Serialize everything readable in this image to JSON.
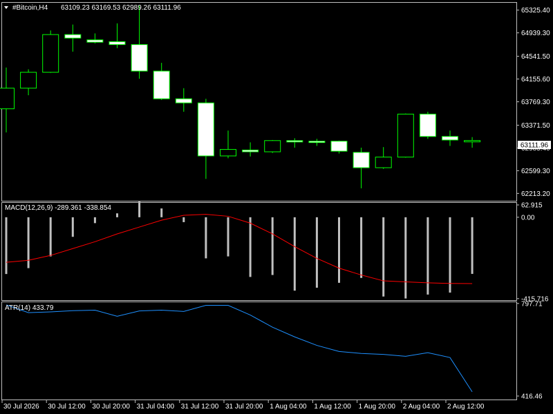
{
  "header": {
    "symbol_label": "#Bitcoin,H4",
    "ohlc_text": "63109.23 63169.53 62989.26 63111.96"
  },
  "price_axis": {
    "ticks": [
      "65325.40",
      "64939.30",
      "64541.50",
      "64155.60",
      "63769.30",
      "63371.50",
      "62985.40",
      "62599.30",
      "62213.20"
    ],
    "current_price": "63111.96"
  },
  "macd": {
    "label": "MACD(12,26,9) -289.361 -338.854",
    "axis_ticks": [
      "62.915",
      "0.00",
      "-415.716"
    ]
  },
  "atr": {
    "label": "ATR(14) 433.79",
    "axis_ticks": [
      "797.71",
      "416.46"
    ]
  },
  "time_axis": {
    "labels": [
      "30 Jul 2026",
      "30 Jul 12:00",
      "30 Jul 20:00",
      "31 Jul 04:00",
      "31 Jul 12:00",
      "31 Jul 20:00",
      "1 Aug 04:00",
      "1 Aug 12:00",
      "1 Aug 20:00",
      "2 Aug 04:00",
      "2 Aug 12:00"
    ]
  },
  "colors": {
    "background": "#000000",
    "frame": "#c0c0c0",
    "bull_candle_body": "#000000",
    "bear_candle_body": "#ffffff",
    "candle_wick": "#00ff00",
    "macd_histogram": "#c0c0c0",
    "macd_signal": "#ff0000",
    "atr_line": "#1e90ff",
    "text": "#ffffff"
  },
  "chart_data": [
    {
      "type": "candlestick",
      "title": "#Bitcoin,H4",
      "ylim": [
        62100,
        65450
      ],
      "y_ticks": [
        65325.4,
        64939.3,
        64541.5,
        64155.6,
        63769.3,
        63371.5,
        62985.4,
        62599.3,
        62213.2
      ],
      "candles": [
        {
          "o": 63650,
          "h": 64350,
          "l": 63250,
          "c": 64000
        },
        {
          "o": 64000,
          "h": 64320,
          "l": 63880,
          "c": 64270
        },
        {
          "o": 64270,
          "h": 64980,
          "l": 64260,
          "c": 64910
        },
        {
          "o": 64910,
          "h": 65080,
          "l": 64620,
          "c": 64850
        },
        {
          "o": 64820,
          "h": 64930,
          "l": 64760,
          "c": 64780
        },
        {
          "o": 64790,
          "h": 65100,
          "l": 64680,
          "c": 64740
        },
        {
          "o": 64740,
          "h": 65400,
          "l": 64160,
          "c": 64290
        },
        {
          "o": 64290,
          "h": 64430,
          "l": 63800,
          "c": 63820
        },
        {
          "o": 63820,
          "h": 64000,
          "l": 63600,
          "c": 63750
        },
        {
          "o": 63750,
          "h": 63820,
          "l": 62460,
          "c": 62850
        },
        {
          "o": 62850,
          "h": 63280,
          "l": 62810,
          "c": 62960
        },
        {
          "o": 62950,
          "h": 63080,
          "l": 62840,
          "c": 62920
        },
        {
          "o": 62920,
          "h": 63120,
          "l": 62900,
          "c": 63110
        },
        {
          "o": 63110,
          "h": 63150,
          "l": 62990,
          "c": 63100
        },
        {
          "o": 63100,
          "h": 63140,
          "l": 63020,
          "c": 63080
        },
        {
          "o": 63100,
          "h": 63110,
          "l": 62890,
          "c": 62930
        },
        {
          "o": 62910,
          "h": 62990,
          "l": 62300,
          "c": 62650
        },
        {
          "o": 62650,
          "h": 63000,
          "l": 62630,
          "c": 62830
        },
        {
          "o": 62830,
          "h": 63570,
          "l": 62820,
          "c": 63560
        },
        {
          "o": 63560,
          "h": 63600,
          "l": 63140,
          "c": 63180
        },
        {
          "o": 63180,
          "h": 63280,
          "l": 63020,
          "c": 63120
        },
        {
          "o": 63109.23,
          "h": 63169.53,
          "l": 62989.26,
          "c": 63111.96
        }
      ]
    },
    {
      "type": "bar+line",
      "title": "MACD(12,26,9) -289.361 -338.854",
      "ylim": [
        -420,
        70
      ],
      "histogram": [
        -290,
        -260,
        -200,
        -100,
        -30,
        20,
        80,
        45,
        -25,
        -210,
        -200,
        -305,
        -295,
        -375,
        -360,
        -335,
        -310,
        -405,
        -415,
        -395,
        -385,
        -289.361
      ],
      "signal": [
        -230,
        -220,
        -195,
        -160,
        -125,
        -85,
        -50,
        -15,
        10,
        15,
        5,
        -30,
        -85,
        -150,
        -210,
        -260,
        -295,
        -325,
        -330,
        -335,
        -338,
        -338.854
      ]
    },
    {
      "type": "line",
      "title": "ATR(14) 433.79",
      "ylim": [
        405,
        800
      ],
      "values": [
        792,
        760,
        763,
        768,
        770,
        745,
        767,
        770,
        765,
        790,
        790,
        750,
        700,
        660,
        625,
        600,
        592,
        588,
        580,
        595,
        575,
        433.79
      ]
    }
  ]
}
